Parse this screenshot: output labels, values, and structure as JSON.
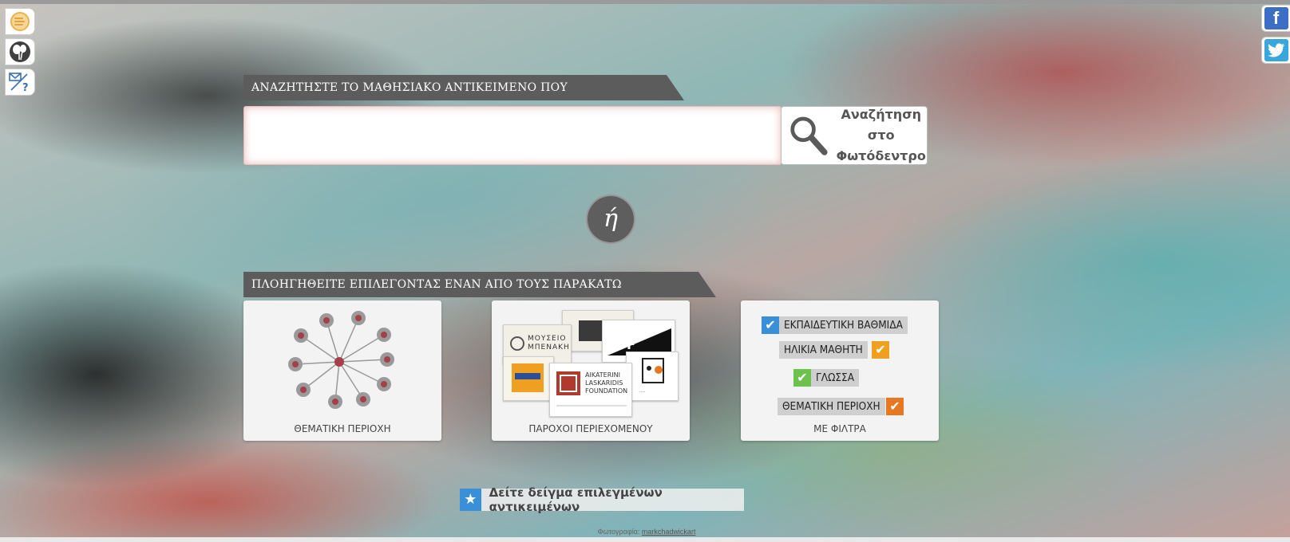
{
  "search": {
    "heading": "ΑΝΑΖΗΤΗΣΤΕ ΤΟ ΜΑΘΗΣΙΑΚΟ ΑΝΤΙΚΕΙΜΕΝΟ ΠΟΥ ΕΠΙΘΥΜΕΙΤΕ:",
    "input_value": "",
    "button_label_line1": "Αναζήτηση στο",
    "button_label_line2": "Φωτόδεντρο"
  },
  "or_label": "ή",
  "browse": {
    "heading": "ΠΛΟΗΓΗΘΕΙΤΕ ΕΠΙΛΕΓΟΝΤΑΣ ΕΝΑΝ ΑΠΟ ΤΟΥΣ ΠΑΡΑΚΑΤΩ ΤΡΟΠΟΥΣ:",
    "cards": [
      {
        "caption": "ΘΕΜΑΤΙΚΗ ΠΕΡΙΟΧΗ",
        "icon": "network-icon"
      },
      {
        "caption": "ΠΑΡΟΧΟΙ ΠΕΡΙΕΧΟΜΕΝΟΥ",
        "icon": "providers-collage"
      },
      {
        "caption": "ΜΕ ΦΙΛΤΡΑ",
        "icon": "filters-icon"
      }
    ],
    "providers": {
      "museum_line1": "ΜΟΥΣΕΙΟ",
      "museum_line2": "ΜΠΕΝΑΚΗ",
      "laskaridis_line1": "AIKATERINI",
      "laskaridis_line2": "LASKARIDIS",
      "laskaridis_line3": "FOUNDATION"
    },
    "filters": {
      "educational_level": "ΕΚΠΑΙΔΕΥΤΙΚΗ ΒΑΘΜΙΔΑ",
      "student_age": "ΗΛΙΚΙΑ ΜΑΘΗΤΗ",
      "language": "ΓΛΩΣΣΑ",
      "subject_area": "ΘΕΜΑΤΙΚΗ ΠΕΡΙΟΧΗ"
    }
  },
  "featured_link": "Δείτε δείγμα επιλεγμένων αντικειμένων",
  "credit": {
    "prefix": "Φωτογραφία:",
    "author": "markchadwickart"
  },
  "social": {
    "facebook_glyph": "f",
    "twitter_glyph": "t"
  },
  "colors": {
    "banner": "#5c5c5c",
    "blue_check": "#3a90d8",
    "orange_check": "#f0a020",
    "green_check": "#6cc24a",
    "dark_orange_check": "#e87722"
  }
}
